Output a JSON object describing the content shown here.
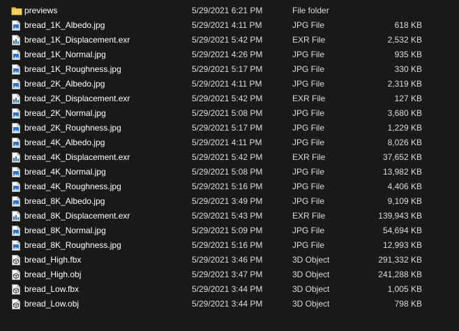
{
  "files": [
    {
      "name": "previews",
      "date": "5/29/2021 6:21 PM",
      "type": "File folder",
      "size": "",
      "icon": "folder-icon"
    },
    {
      "name": "bread_1K_Albedo.jpg",
      "date": "5/29/2021 4:11 PM",
      "type": "JPG File",
      "size": "618 KB",
      "icon": "image-file-icon"
    },
    {
      "name": "bread_1K_Displacement.exr",
      "date": "5/29/2021 5:42 PM",
      "type": "EXR File",
      "size": "2,532 KB",
      "icon": "exr-file-icon"
    },
    {
      "name": "bread_1K_Normal.jpg",
      "date": "5/29/2021 4:26 PM",
      "type": "JPG File",
      "size": "935 KB",
      "icon": "image-file-icon"
    },
    {
      "name": "bread_1K_Roughness.jpg",
      "date": "5/29/2021 5:17 PM",
      "type": "JPG File",
      "size": "330 KB",
      "icon": "image-file-icon"
    },
    {
      "name": "bread_2K_Albedo.jpg",
      "date": "5/29/2021 4:11 PM",
      "type": "JPG File",
      "size": "2,319 KB",
      "icon": "image-file-icon"
    },
    {
      "name": "bread_2K_Displacement.exr",
      "date": "5/29/2021 5:42 PM",
      "type": "EXR File",
      "size": "127 KB",
      "icon": "exr-file-icon"
    },
    {
      "name": "bread_2K_Normal.jpg",
      "date": "5/29/2021 5:08 PM",
      "type": "JPG File",
      "size": "3,680 KB",
      "icon": "image-file-icon"
    },
    {
      "name": "bread_2K_Roughness.jpg",
      "date": "5/29/2021 5:17 PM",
      "type": "JPG File",
      "size": "1,229 KB",
      "icon": "image-file-icon"
    },
    {
      "name": "bread_4K_Albedo.jpg",
      "date": "5/29/2021 4:11 PM",
      "type": "JPG File",
      "size": "8,026 KB",
      "icon": "image-file-icon"
    },
    {
      "name": "bread_4K_Displacement.exr",
      "date": "5/29/2021 5:42 PM",
      "type": "EXR File",
      "size": "37,652 KB",
      "icon": "exr-file-icon"
    },
    {
      "name": "bread_4K_Normal.jpg",
      "date": "5/29/2021 5:08 PM",
      "type": "JPG File",
      "size": "13,982 KB",
      "icon": "image-file-icon"
    },
    {
      "name": "bread_4K_Roughness.jpg",
      "date": "5/29/2021 5:16 PM",
      "type": "JPG File",
      "size": "4,406 KB",
      "icon": "image-file-icon"
    },
    {
      "name": "bread_8K_Albedo.jpg",
      "date": "5/29/2021 3:49 PM",
      "type": "JPG File",
      "size": "9,109 KB",
      "icon": "image-file-icon"
    },
    {
      "name": "bread_8K_Displacement.exr",
      "date": "5/29/2021 5:43 PM",
      "type": "EXR File",
      "size": "139,943 KB",
      "icon": "exr-file-icon"
    },
    {
      "name": "bread_8K_Normal.jpg",
      "date": "5/29/2021 5:09 PM",
      "type": "JPG File",
      "size": "54,694 KB",
      "icon": "image-file-icon"
    },
    {
      "name": "bread_8K_Roughness.jpg",
      "date": "5/29/2021 5:16 PM",
      "type": "JPG File",
      "size": "12,993 KB",
      "icon": "image-file-icon"
    },
    {
      "name": "bread_High.fbx",
      "date": "5/29/2021 3:46 PM",
      "type": "3D Object",
      "size": "291,332 KB",
      "icon": "3d-object-icon"
    },
    {
      "name": "bread_High.obj",
      "date": "5/29/2021 3:47 PM",
      "type": "3D Object",
      "size": "241,288 KB",
      "icon": "3d-object-icon"
    },
    {
      "name": "bread_Low.fbx",
      "date": "5/29/2021 3:44 PM",
      "type": "3D Object",
      "size": "1,005 KB",
      "icon": "3d-object-icon"
    },
    {
      "name": "bread_Low.obj",
      "date": "5/29/2021 3:44 PM",
      "type": "3D Object",
      "size": "798 KB",
      "icon": "3d-object-icon"
    }
  ],
  "colors": {
    "background": "#191919",
    "text_primary": "#ffffff",
    "text_secondary": "#dcdcdc",
    "folder": "#e8b83c",
    "file_blue": "#2f6fc6"
  }
}
